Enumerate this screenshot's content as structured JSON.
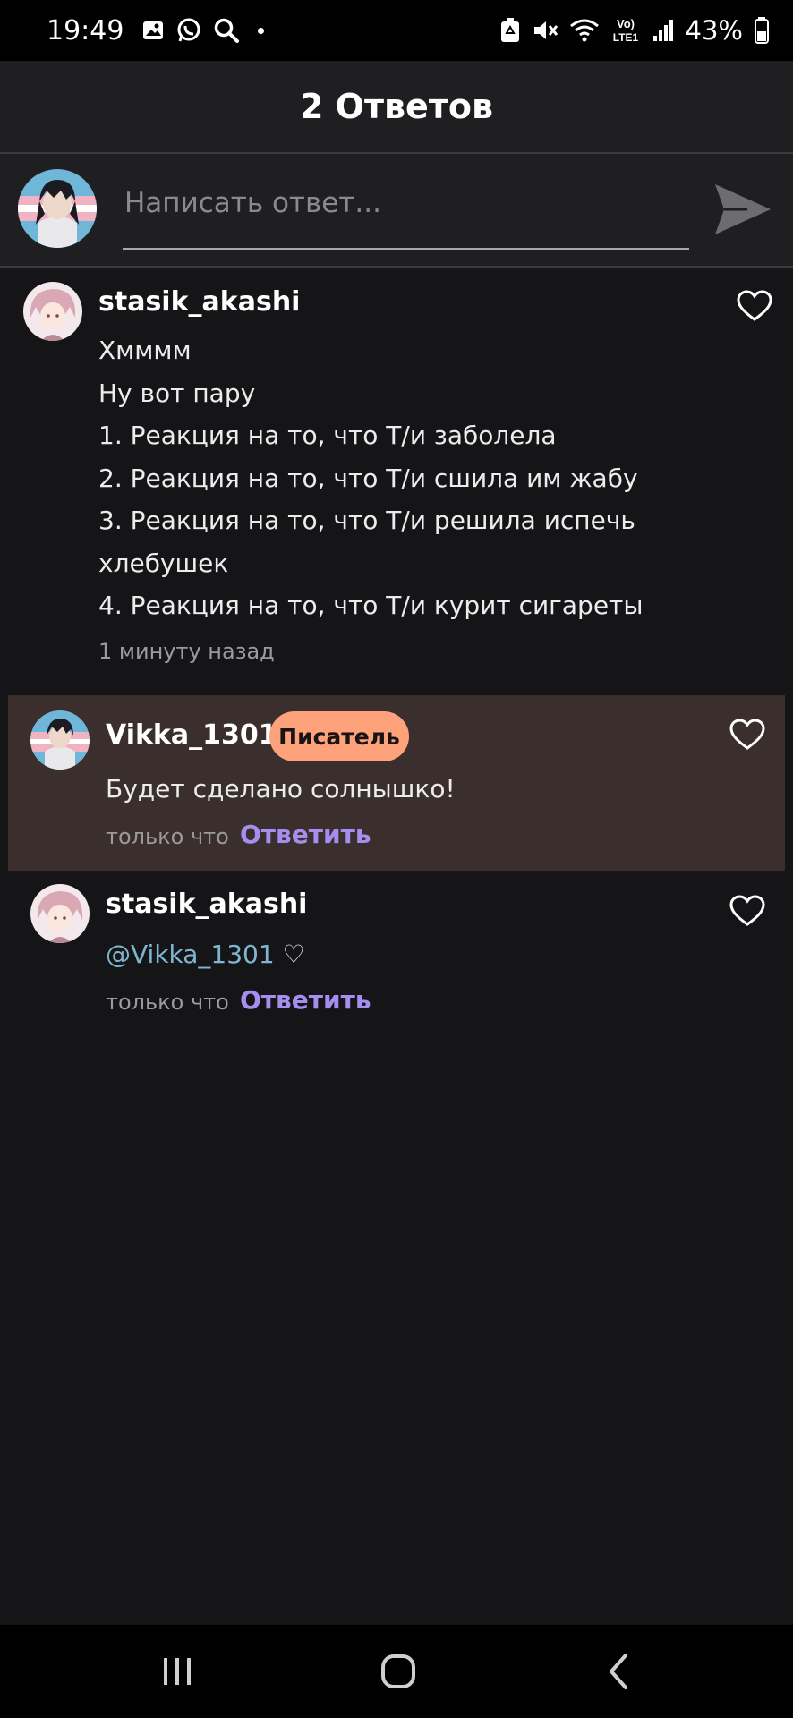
{
  "status_bar": {
    "time": "19:49",
    "battery": "43%",
    "left_icons": [
      "gallery-icon",
      "whatsapp-icon",
      "search-icon",
      "dot-icon"
    ],
    "right_icons": [
      "recycle-icon",
      "mute-icon",
      "wifi-icon",
      "volte-icon",
      "signal-icon",
      "battery-icon"
    ],
    "volte_top": "Vo)",
    "volte_bottom": "LTE1"
  },
  "header": {
    "title": "2 Ответов"
  },
  "composer": {
    "placeholder": "Написать ответ...",
    "value": "",
    "send_icon": "send-icon"
  },
  "comments": [
    {
      "author": "stasik_akashi",
      "lines": [
        "Хмммм",
        "Ну вот пару",
        "1. Реакция на то, что Т/и заболела",
        "2. Реакция на то, что Т/и сшила им жабу",
        "3. Реакция на то, что Т/и решила испечь",
        "хлебушек",
        "4. Реакция на то, что Т/и курит сигареты"
      ],
      "time": "1 минуту назад"
    },
    {
      "author": "Vikka_1301",
      "badge": "Писатель",
      "text": "Будет сделано солнышко!",
      "time": "только что",
      "reply": "Ответить"
    },
    {
      "author": "stasik_akashi",
      "mention": "@Vikka_1301",
      "suffix": " ♡",
      "time": "только что",
      "reply": "Ответить"
    }
  ],
  "colors": {
    "background": "#151417",
    "header": "#1f1e21",
    "highlight": "#3a2f2c",
    "badge": "#fda27a",
    "reply_link": "#a58ef0",
    "mention": "#7fb6cf"
  },
  "nav_bar": {
    "icons": [
      "recent-apps-icon",
      "home-icon",
      "back-icon"
    ]
  }
}
